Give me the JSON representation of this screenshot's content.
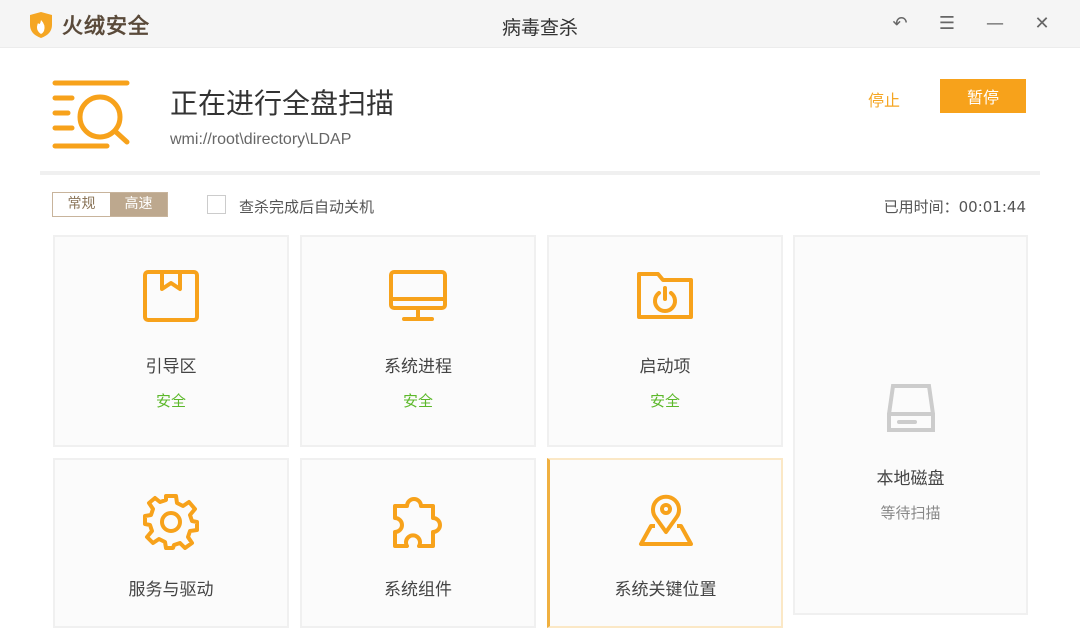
{
  "app": {
    "name": "火绒安全",
    "window_title": "病毒查杀"
  },
  "window_controls": [
    {
      "name": "back"
    },
    {
      "name": "menu"
    },
    {
      "name": "minimize"
    },
    {
      "name": "close"
    }
  ],
  "scan": {
    "title": "正在进行全盘扫描",
    "path": "wmi://root\\directory\\LDAP",
    "stop_label": "停止",
    "pause_label": "暂停"
  },
  "options": {
    "mode_normal": "常规",
    "mode_fast": "高速",
    "selected_mode": "高速",
    "auto_shutdown_label": "查杀完成后自动关机",
    "auto_shutdown_checked": false,
    "elapsed_label": "已用时间：",
    "elapsed": "00:01:44"
  },
  "cards": [
    {
      "name": "引导区",
      "status": "安全"
    },
    {
      "name": "系统进程",
      "status": "安全"
    },
    {
      "name": "启动项",
      "status": "安全"
    },
    {
      "name": "本地磁盘",
      "status": "等待扫描"
    },
    {
      "name": "服务与驱动"
    },
    {
      "name": "系统组件"
    },
    {
      "name": "系统关键位置"
    }
  ],
  "colors": {
    "accent": "#f7a21b",
    "safe": "#5cb82a",
    "mode_selected": "#bda88e"
  }
}
